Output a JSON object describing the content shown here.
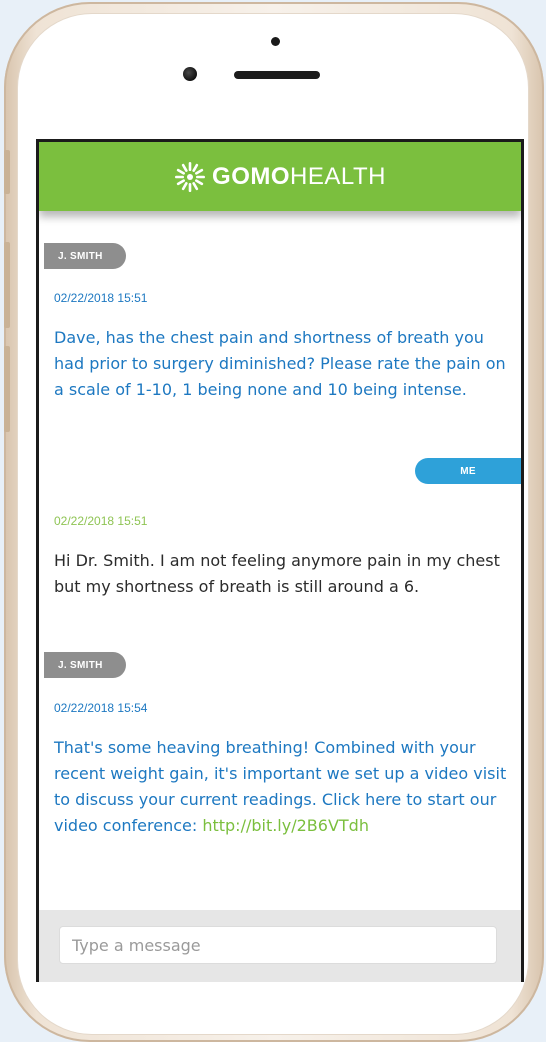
{
  "app": {
    "brand_bold": "GOMO",
    "brand_light": "HEALTH"
  },
  "messages": [
    {
      "sender": "J. SMITH",
      "timestamp": "02/22/2018 15:51",
      "text": "Dave, has the chest pain and shortness of breath you had prior to surgery diminished? Please rate the pain on a scale of 1-10, 1 being none and 10 being intense."
    },
    {
      "sender": "ME",
      "timestamp": "02/22/2018 15:51",
      "text": "Hi Dr. Smith. I am not feeling anymore pain in my chest but my shortness of breath is still around a 6."
    },
    {
      "sender": "J. SMITH",
      "timestamp": "02/22/2018 15:54",
      "text": "That's some heaving breathing! Combined with your recent weight gain, it's important we set up a video visit to discuss your current readings. Click here to start our video conference:",
      "link": "http://bit.ly/2B6VTdh"
    }
  ],
  "composer": {
    "placeholder": "Type a message"
  },
  "colors": {
    "header": "#7bbf3e",
    "doctor_text": "#1d78c1",
    "me_badge": "#2ea1d9",
    "doctor_badge": "#8e8e8e",
    "me_timestamp": "#8fc454"
  }
}
